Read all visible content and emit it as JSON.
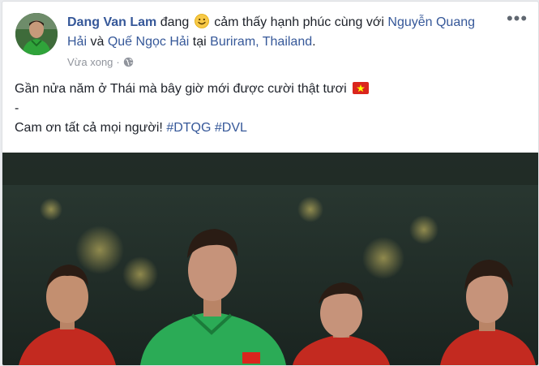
{
  "post": {
    "author": "Dang Van Lam",
    "feeling_prefix": "đang",
    "feeling_text": "cảm thấy hạnh phúc cùng với",
    "tagged_1": "Nguyễn Quang Hải",
    "conj": "và",
    "tagged_2": "Quế Ngọc Hải",
    "location_prefix": "tại",
    "location": "Buriram, Thailand",
    "location_suffix": ".",
    "timestamp": "Vừa xong",
    "timestamp_sep": "·",
    "more_label": "•••",
    "text_line_1": "Gần nửa năm ở Thái mà bây giờ mới được cười thật tươi",
    "text_line_2": "-",
    "text_line_3": "Cam ơn tất cả mọi người!",
    "hashtag_1": "#DTQG",
    "hashtag_2": "#DVL"
  },
  "icons": {
    "feeling": "smiling-face-emoji",
    "flag": "vietnam-flag",
    "privacy": "globe-icon",
    "more": "more-options-icon"
  },
  "colors": {
    "link": "#365899",
    "text": "#1d2129",
    "meta": "#90949c",
    "flag_red": "#da251d",
    "flag_star": "#ffff00"
  }
}
